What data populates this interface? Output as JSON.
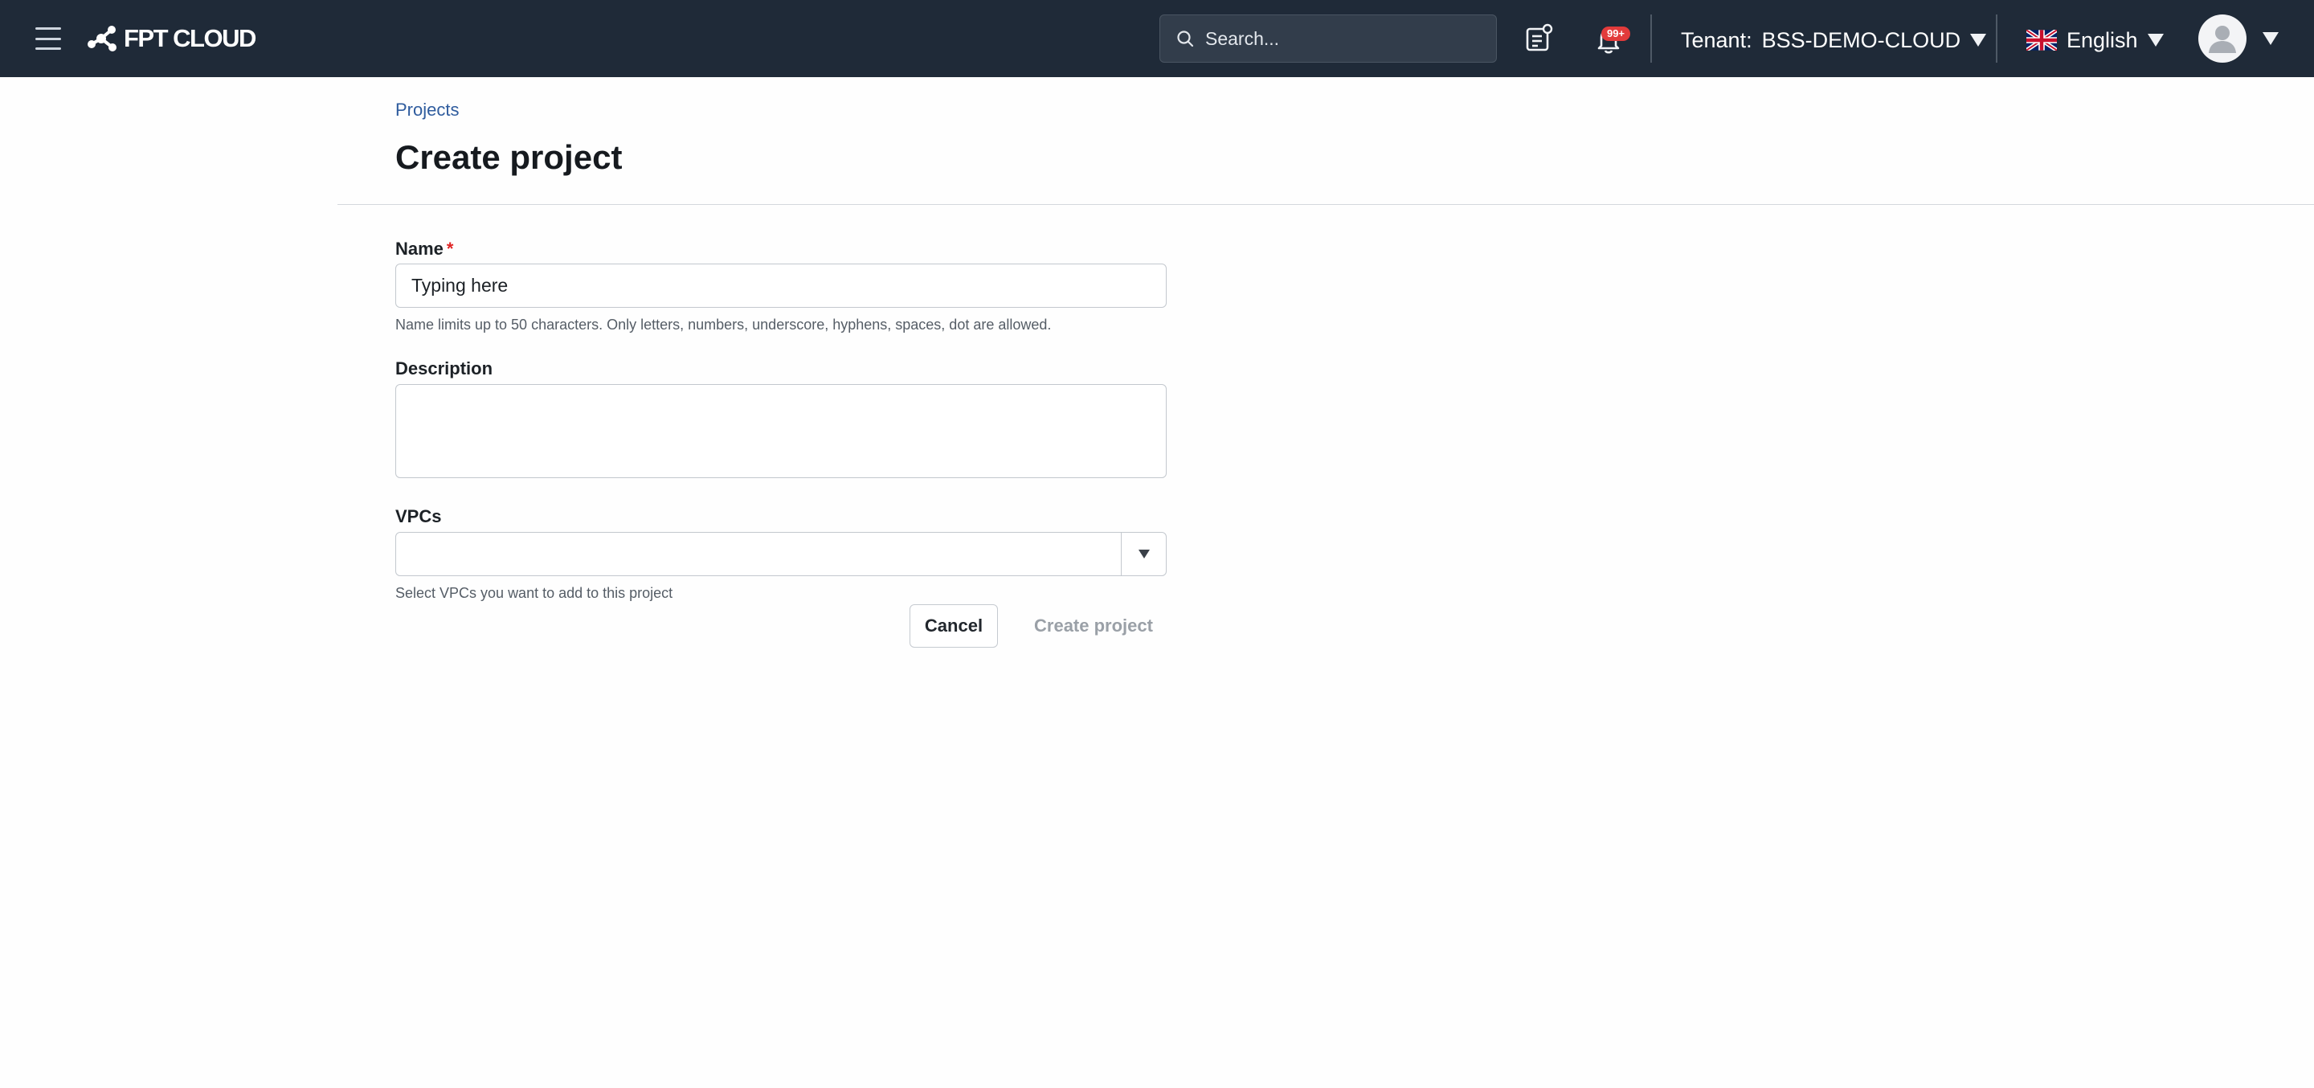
{
  "header": {
    "brand": "FPT CLOUD",
    "search": {
      "placeholder": "Search..."
    },
    "notifications": {
      "badge": "99+"
    },
    "tenant": {
      "label": "Tenant:",
      "value": "BSS-DEMO-CLOUD"
    },
    "language": {
      "value": "English"
    },
    "icons": {
      "menu": "hamburger-menu-icon",
      "search": "search-icon",
      "ticket": "ticket-icon",
      "bell": "bell-icon",
      "flag": "uk-flag-icon",
      "user": "user-avatar-icon",
      "caret": "caret-down-icon"
    },
    "colors": {
      "background": "#1f2a38",
      "badge": "#e23b3b"
    }
  },
  "breadcrumb": {
    "projects": "Projects"
  },
  "page": {
    "title": "Create project"
  },
  "form": {
    "name": {
      "label": "Name",
      "required_mark": "*",
      "value": "Typing here",
      "help": "Name limits up to 50 characters. Only letters, numbers, underscore, hyphens, spaces, dot are allowed."
    },
    "description": {
      "label": "Description",
      "value": ""
    },
    "vpcs": {
      "label": "VPCs",
      "selected": "",
      "help": "Select VPCs you want to add to this project"
    },
    "actions": {
      "cancel": "Cancel",
      "submit": "Create project"
    }
  }
}
